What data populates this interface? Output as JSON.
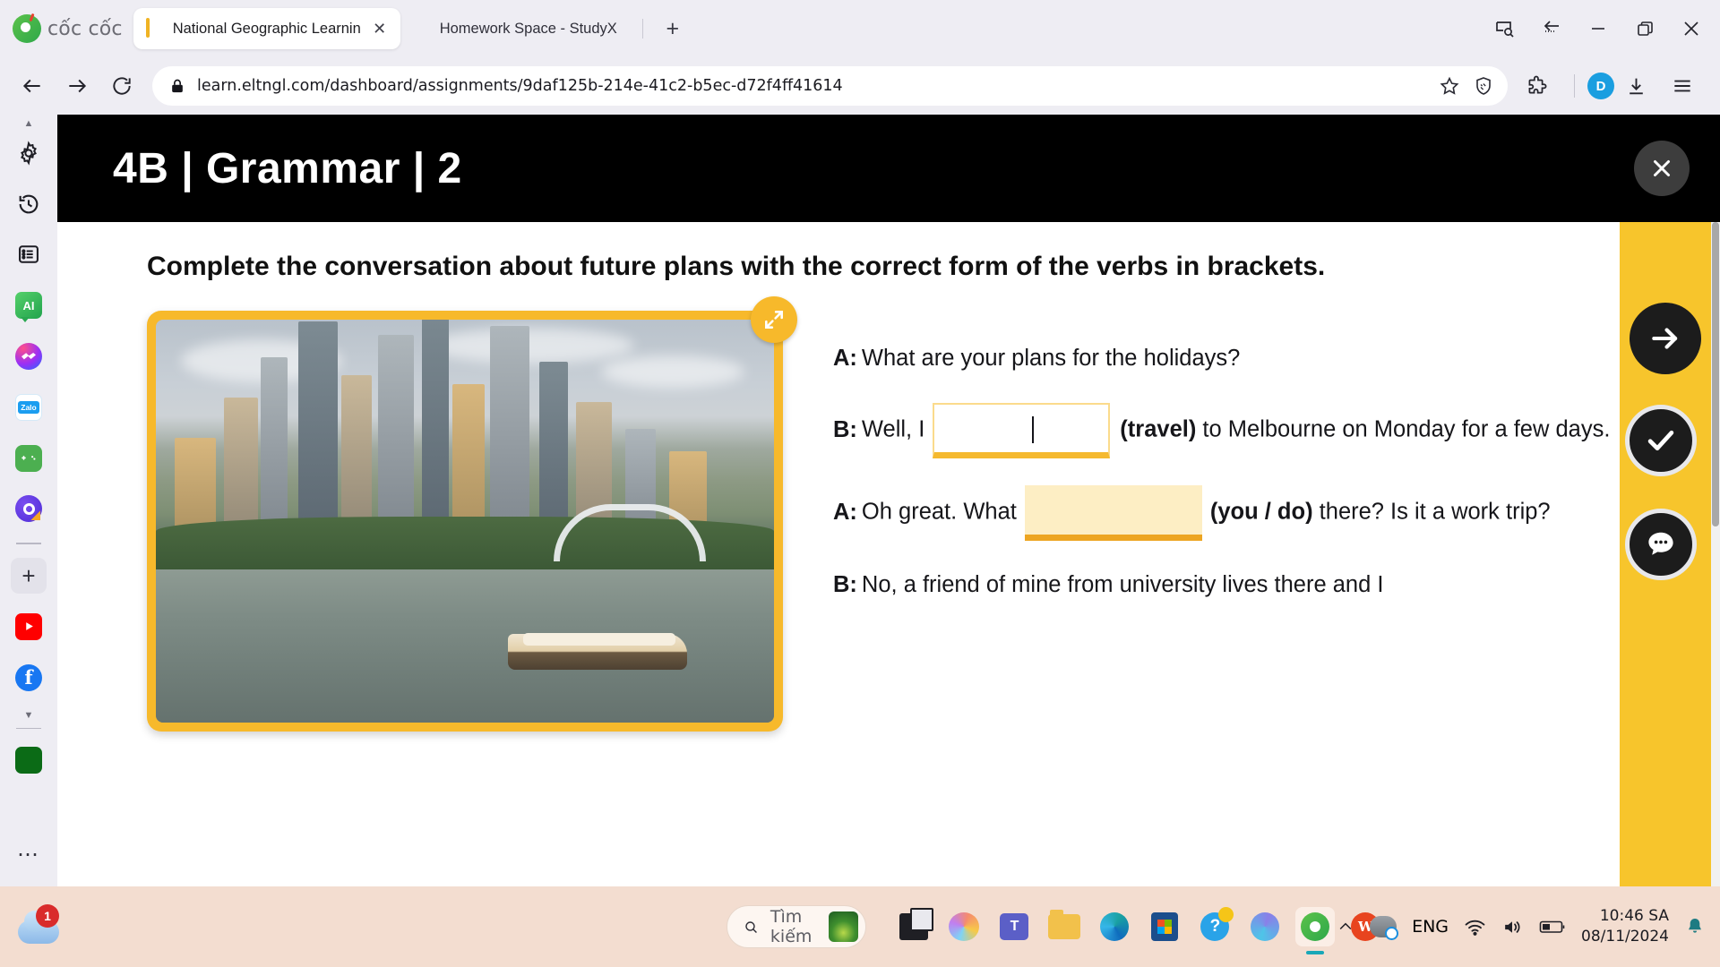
{
  "browser": {
    "brand_name": "cốc cốc",
    "tabs": [
      {
        "title": "National Geographic Learning",
        "favicon": "book-icon",
        "active": true
      },
      {
        "title": "Homework Space - StudyX",
        "favicon": "cube-icon",
        "active": false
      }
    ],
    "new_tab_label": "+",
    "url": "learn.eltngl.com/dashboard/assignments/9daf125b-214e-41c2-b5ec-d72f4ff41614",
    "profile_initial": "D",
    "window_controls": [
      "search-page-icon",
      "back-dotted-icon",
      "minimize-icon",
      "restore-icon",
      "close-icon"
    ],
    "nav_icons": [
      "back-arrow-icon",
      "forward-arrow-icon",
      "reload-icon"
    ],
    "omnibox_icons": [
      "lock-icon",
      "bookmark-star-icon",
      "shield-icon"
    ],
    "toolbar_icons": [
      "extensions-puzzle-icon",
      "downloads-icon",
      "menu-hamburger-icon"
    ]
  },
  "sidebar": {
    "items": [
      {
        "name": "settings",
        "icon": "gear-icon"
      },
      {
        "name": "history",
        "icon": "history-clock-icon"
      },
      {
        "name": "reading-list",
        "icon": "list-icon"
      },
      {
        "name": "ai-assistant",
        "icon": "ai-icon",
        "label": "AI"
      },
      {
        "name": "messenger",
        "icon": "messenger-icon"
      },
      {
        "name": "zalo",
        "icon": "zalo-icon",
        "label": "Zalo"
      },
      {
        "name": "games",
        "icon": "game-controller-icon"
      },
      {
        "name": "quick-search",
        "icon": "q-search-icon"
      },
      {
        "name": "add-shortcut",
        "icon": "plus-icon"
      },
      {
        "name": "youtube",
        "icon": "youtube-icon"
      },
      {
        "name": "facebook",
        "icon": "facebook-icon",
        "label": "f"
      },
      {
        "name": "expand-more",
        "icon": "chevron-down-icon"
      },
      {
        "name": "green-app",
        "icon": "app-tile-icon"
      },
      {
        "name": "more-options",
        "icon": "ellipsis-icon"
      }
    ]
  },
  "lesson": {
    "title": "4B | Grammar | 2",
    "close_label": "✕",
    "instruction": "Complete the conversation about future plans with the correct form of the verbs in brackets.",
    "expand_icon": "expand-arrows-icon"
  },
  "conversation": {
    "lines": [
      {
        "speaker": "A:",
        "before": "What are your plans for the holidays?",
        "blank": null,
        "cue": null,
        "after": ""
      },
      {
        "speaker": "B:",
        "before": "Well, I",
        "blank": {
          "value": "",
          "state": "focused"
        },
        "cue": "(travel)",
        "after": "to Melbourne on Monday for a few days."
      },
      {
        "speaker": "A:",
        "before": "Oh great. What",
        "blank": {
          "value": "",
          "state": "empty"
        },
        "cue": "(you / do)",
        "after": "there? Is it a work trip?"
      },
      {
        "speaker": "B:",
        "before": "No, a friend of mine from university lives there and I",
        "blank": null,
        "cue": null,
        "after": ""
      }
    ]
  },
  "action_rail": {
    "buttons": [
      {
        "name": "next",
        "icon": "arrow-right-icon"
      },
      {
        "name": "check-answers",
        "icon": "checkmark-icon"
      },
      {
        "name": "feedback-chat",
        "icon": "chat-bubble-icon"
      }
    ],
    "color": "#f7c52c"
  },
  "taskbar": {
    "notification_count": "1",
    "start_label": "start-icon",
    "search_placeholder": "Tìm kiếm",
    "apps": [
      {
        "name": "task-view",
        "icon": "task-view-icon"
      },
      {
        "name": "copilot",
        "icon": "copilot-icon"
      },
      {
        "name": "teams",
        "icon": "teams-icon",
        "label": "T"
      },
      {
        "name": "file-explorer",
        "icon": "folder-icon"
      },
      {
        "name": "edge",
        "icon": "edge-icon"
      },
      {
        "name": "microsoft-store",
        "icon": "store-icon"
      },
      {
        "name": "get-help",
        "icon": "help-icon",
        "label": "?"
      },
      {
        "name": "microsoft-365",
        "icon": "m365-icon"
      },
      {
        "name": "coc-coc-browser",
        "icon": "coccoc-icon",
        "active": true
      },
      {
        "name": "wps-office",
        "icon": "wps-icon",
        "label": "W"
      }
    ],
    "tray": {
      "overflow": "chevron-up-icon",
      "onedrive": "onedrive-icon",
      "language": "ENG",
      "wifi": "wifi-icon",
      "volume": "volume-icon",
      "battery": "battery-icon",
      "time": "10:46 SA",
      "date": "08/11/2024",
      "notifications": "bell-icon"
    }
  }
}
